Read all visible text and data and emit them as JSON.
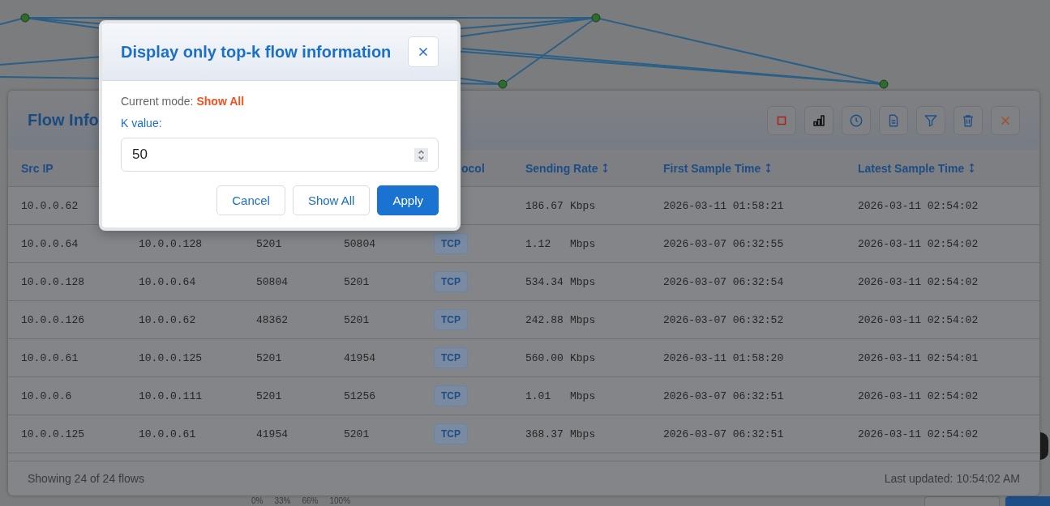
{
  "panel": {
    "title": "Flow Info",
    "toolbar": [
      {
        "kind": "stop"
      },
      {
        "kind": "chart"
      },
      {
        "kind": "clock"
      },
      {
        "kind": "document"
      },
      {
        "kind": "filter"
      },
      {
        "kind": "trash"
      },
      {
        "kind": "close"
      }
    ],
    "columns": [
      {
        "label": "Src IP",
        "sortable": false
      },
      {
        "label": "ocol",
        "sortable": false
      },
      {
        "label": "Sending Rate",
        "sortable": true
      },
      {
        "label": "First Sample Time",
        "sortable": true
      },
      {
        "label": "Latest Sample Time",
        "sortable": true
      }
    ],
    "rows": [
      {
        "src_ip": "10.0.0.62",
        "rate_value": "186.67",
        "rate_unit": "Kbps",
        "first_sample": "2026-03-11 01:58:21",
        "latest_sample": "2026-03-11 02:54:02"
      },
      {
        "src_ip": "10.0.0.64",
        "dst_ip": "10.0.0.128",
        "src_port": "5201",
        "dst_port": "50804",
        "protocol": "TCP",
        "rate_value": "1.12",
        "rate_unit": "Mbps",
        "first_sample": "2026-03-07 06:32:55",
        "latest_sample": "2026-03-11 02:54:02"
      },
      {
        "src_ip": "10.0.0.128",
        "dst_ip": "10.0.0.64",
        "src_port": "50804",
        "dst_port": "5201",
        "protocol": "TCP",
        "rate_value": "534.34",
        "rate_unit": "Mbps",
        "first_sample": "2026-03-07 06:32:54",
        "latest_sample": "2026-03-11 02:54:02"
      },
      {
        "src_ip": "10.0.0.126",
        "dst_ip": "10.0.0.62",
        "src_port": "48362",
        "dst_port": "5201",
        "protocol": "TCP",
        "rate_value": "242.88",
        "rate_unit": "Mbps",
        "first_sample": "2026-03-07 06:32:52",
        "latest_sample": "2026-03-11 02:54:02"
      },
      {
        "src_ip": "10.0.0.61",
        "dst_ip": "10.0.0.125",
        "src_port": "5201",
        "dst_port": "41954",
        "protocol": "TCP",
        "rate_value": "560.00",
        "rate_unit": "Kbps",
        "first_sample": "2026-03-11 01:58:20",
        "latest_sample": "2026-03-11 02:54:01"
      },
      {
        "src_ip": "10.0.0.6",
        "dst_ip": "10.0.0.111",
        "src_port": "5201",
        "dst_port": "51256",
        "protocol": "TCP",
        "rate_value": "1.01",
        "rate_unit": "Mbps",
        "first_sample": "2026-03-07 06:32:51",
        "latest_sample": "2026-03-11 02:54:02"
      },
      {
        "src_ip": "10.0.0.125",
        "dst_ip": "10.0.0.61",
        "src_port": "41954",
        "dst_port": "5201",
        "protocol": "TCP",
        "rate_value": "368.37",
        "rate_unit": "Mbps",
        "first_sample": "2026-03-07 06:32:51",
        "latest_sample": "2026-03-11 02:54:02"
      }
    ],
    "footer_count": "Showing 24 of 24 flows",
    "footer_updated": "Last updated: 10:54:02 AM"
  },
  "legend": [
    "0%",
    "33%",
    "66%",
    "100%"
  ],
  "dialog": {
    "title": "Display only top-k flow information",
    "mode_label": "Current mode:",
    "mode_value": "Show All",
    "k_label": "K value:",
    "k_value": "50",
    "buttons": [
      {
        "label": "Cancel",
        "primary": false
      },
      {
        "label": "Show All",
        "primary": false
      },
      {
        "label": "Apply",
        "primary": true
      }
    ]
  }
}
